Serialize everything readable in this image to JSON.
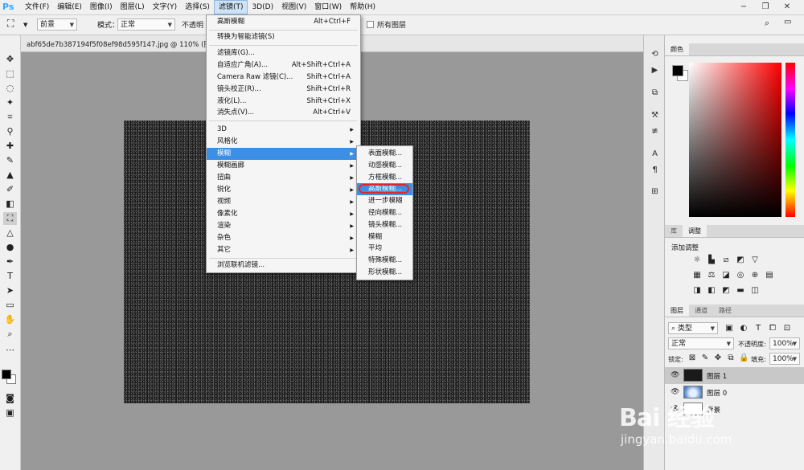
{
  "app": {
    "logo": "Ps"
  },
  "menubar": {
    "items": [
      "文件(F)",
      "编辑(E)",
      "图像(I)",
      "图层(L)",
      "文字(Y)",
      "选择(S)",
      "滤镜(T)",
      "3D(D)",
      "视图(V)",
      "窗口(W)",
      "帮助(H)"
    ],
    "active_index": 6
  },
  "window_controls": {
    "minimize": "−",
    "restore": "❐",
    "close": "✕"
  },
  "options": {
    "fill_label": "前景",
    "mode_label": "模式：",
    "mode_value": "正常",
    "opacity_label": "不透明",
    "all_layers_label": "所有图层"
  },
  "document": {
    "title": "abf65de7b387194f5f08ef98d595f147.jpg @ 110% (图层 1,"
  },
  "filter_menu": {
    "items": [
      {
        "label": "高斯模糊",
        "shortcut": "Alt+Ctrl+F"
      },
      {
        "label": "转换为智能滤镜(S)",
        "shortcut": ""
      },
      {
        "label": "滤镜库(G)...",
        "shortcut": ""
      },
      {
        "label": "自适应广角(A)...",
        "shortcut": "Alt+Shift+Ctrl+A"
      },
      {
        "label": "Camera Raw 滤镜(C)...",
        "shortcut": "Shift+Ctrl+A"
      },
      {
        "label": "镜头校正(R)...",
        "shortcut": "Shift+Ctrl+R"
      },
      {
        "label": "液化(L)...",
        "shortcut": "Shift+Ctrl+X"
      },
      {
        "label": "消失点(V)...",
        "shortcut": "Alt+Ctrl+V"
      },
      {
        "label": "3D",
        "shortcut": ""
      },
      {
        "label": "风格化",
        "shortcut": ""
      },
      {
        "label": "模糊",
        "shortcut": ""
      },
      {
        "label": "模糊画廊",
        "shortcut": ""
      },
      {
        "label": "扭曲",
        "shortcut": ""
      },
      {
        "label": "锐化",
        "shortcut": ""
      },
      {
        "label": "视频",
        "shortcut": ""
      },
      {
        "label": "像素化",
        "shortcut": ""
      },
      {
        "label": "渲染",
        "shortcut": ""
      },
      {
        "label": "杂色",
        "shortcut": ""
      },
      {
        "label": "其它",
        "shortcut": ""
      },
      {
        "label": "浏览联机滤镜...",
        "shortcut": ""
      }
    ],
    "highlighted_index": 10
  },
  "blur_submenu": {
    "items": [
      "表面模糊...",
      "动感模糊...",
      "方框模糊...",
      "高斯模糊...",
      "进一步模糊",
      "径向模糊...",
      "镜头模糊...",
      "模糊",
      "平均",
      "特殊模糊...",
      "形状模糊..."
    ],
    "highlighted_index": 3
  },
  "color_panel": {
    "tab": "颜色",
    "foreground": "#000000",
    "background": "#ffffff"
  },
  "adjust_panel": {
    "tabs": [
      "库",
      "调整"
    ],
    "active_tab": 1,
    "heading": "添加调整"
  },
  "layers_panel": {
    "tabs": [
      "图层",
      "通道",
      "路径"
    ],
    "active_tab": 0,
    "filter_label": "类型",
    "blend_mode": "正常",
    "opacity_label": "不透明度:",
    "opacity_value": "100%",
    "lock_label": "锁定:",
    "fill_label": "填充:",
    "fill_value": "100%",
    "layers": [
      {
        "name": "图层 1",
        "selected": true
      },
      {
        "name": "图层 0",
        "selected": false
      },
      {
        "name": "背景",
        "selected": false
      }
    ]
  },
  "watermark": {
    "logo": "Bai 经验",
    "url": "jingyan.baidu.com"
  }
}
